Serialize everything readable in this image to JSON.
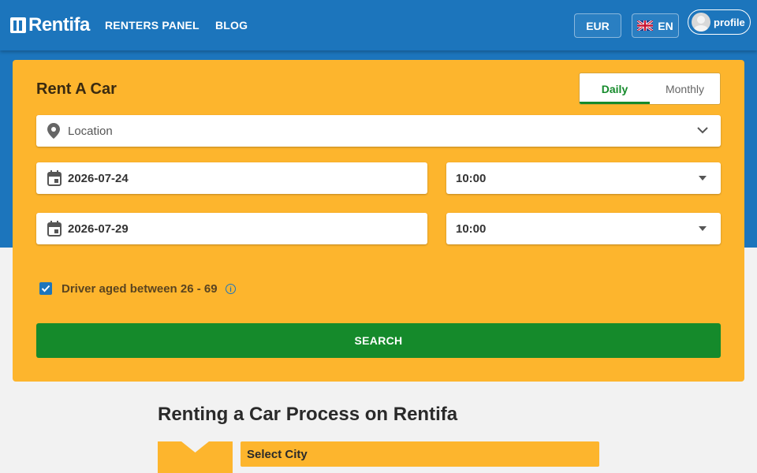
{
  "brand": {
    "name": "Rentifa"
  },
  "nav": {
    "links": [
      {
        "label": "RENTERS PANEL"
      },
      {
        "label": "BLOG"
      }
    ],
    "currency": "EUR",
    "language": "EN",
    "profile": "profile"
  },
  "search_form": {
    "title": "Rent A Car",
    "mode_tabs": [
      {
        "label": "Daily",
        "active": true
      },
      {
        "label": "Monthly",
        "active": false
      }
    ],
    "location": {
      "placeholder": "Location",
      "icon": "location-pin-icon"
    },
    "pickup": {
      "date": "2026-07-24",
      "time": "10:00"
    },
    "dropoff": {
      "date": "2026-07-29",
      "time": "10:00"
    },
    "driver_age": {
      "label": "Driver aged between 26 - 69",
      "checked": true
    },
    "submit_label": "SEARCH"
  },
  "process": {
    "title": "Renting a Car Process on Rentifa",
    "steps": [
      {
        "label": "Select City"
      }
    ]
  },
  "colors": {
    "header_blue": "#1c75bc",
    "card_yellow": "#fdb52d",
    "action_green": "#158a2b",
    "page_bg": "#f2f2f2"
  }
}
